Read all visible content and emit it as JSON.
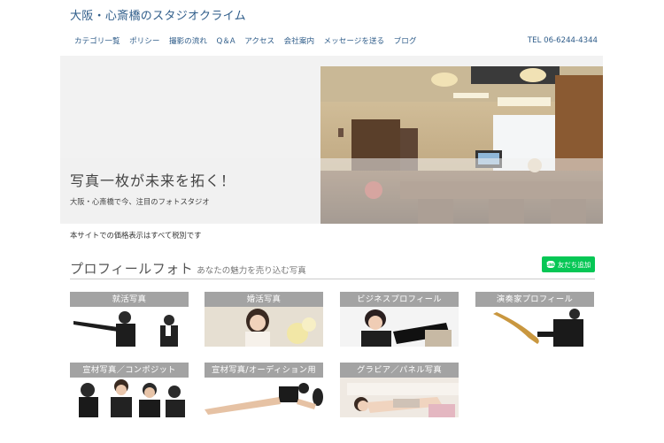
{
  "header": {
    "site_title": "大阪・心斎橋のスタジオクライム",
    "tel": "TEL 06-6244-4344"
  },
  "nav": {
    "items": [
      {
        "label": "カテゴリ一覧"
      },
      {
        "label": "ポリシー"
      },
      {
        "label": "撮影の流れ"
      },
      {
        "label": "Q＆A"
      },
      {
        "label": "アクセス"
      },
      {
        "label": "会社案内"
      },
      {
        "label": "メッセージを送る"
      },
      {
        "label": "ブログ"
      }
    ]
  },
  "hero": {
    "title": "写真一枚が未来を拓く！",
    "subtitle": "大阪・心斎橋で今、注目のフォトスタジオ"
  },
  "notice": {
    "tax": "本サイトでの価格表示はすべて税別です"
  },
  "section": {
    "title": "プロフィールフォト",
    "subtitle": "あなたの魅力を売り込む写真",
    "line_button": "友だち追加",
    "line_icon_text": "LINE"
  },
  "cards": [
    {
      "label": "就活写真"
    },
    {
      "label": "婚活写真"
    },
    {
      "label": "ビジネスプロフィール"
    },
    {
      "label": "演奏家プロフィール"
    },
    {
      "label": "宣材写真／コンポジット"
    },
    {
      "label": "宣材写真/オーディション用"
    },
    {
      "label": "グラビア／パネル写真"
    }
  ],
  "colors": {
    "link": "#2f5d8a",
    "line_green": "#06c755",
    "card_label_bg": "#a3a3a3"
  }
}
